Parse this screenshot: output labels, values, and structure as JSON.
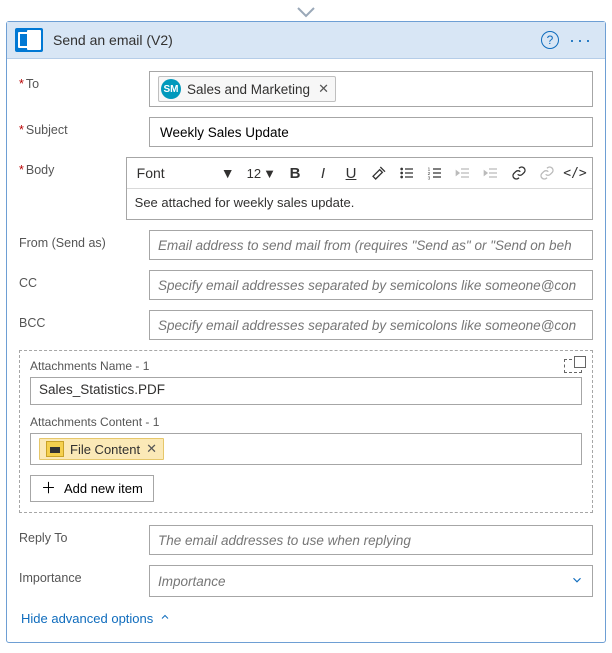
{
  "header": {
    "title": "Send an email (V2)"
  },
  "labels": {
    "to": "To",
    "subject": "Subject",
    "body": "Body",
    "from": "From (Send as)",
    "cc": "CC",
    "bcc": "BCC",
    "replyTo": "Reply To",
    "importance": "Importance"
  },
  "to": {
    "chip_initials": "SM",
    "chip_label": "Sales and Marketing"
  },
  "subject": {
    "value": "Weekly Sales Update"
  },
  "toolbar": {
    "font": "Font",
    "size": "12"
  },
  "body": {
    "content": "See attached for weekly sales update."
  },
  "placeholders": {
    "from": "Email address to send mail from (requires \"Send as\" or \"Send on beh",
    "cc": "Specify email addresses separated by semicolons like someone@con",
    "bcc": "Specify email addresses separated by semicolons like someone@con",
    "replyTo": "The email addresses to use when replying",
    "importance": "Importance"
  },
  "attachments": {
    "name_label": "Attachments Name - 1",
    "name_value": "Sales_Statistics.PDF",
    "content_label": "Attachments Content - 1",
    "file_chip": "File Content",
    "add_label": "Add new item"
  },
  "footer": {
    "toggle": "Hide advanced options"
  }
}
